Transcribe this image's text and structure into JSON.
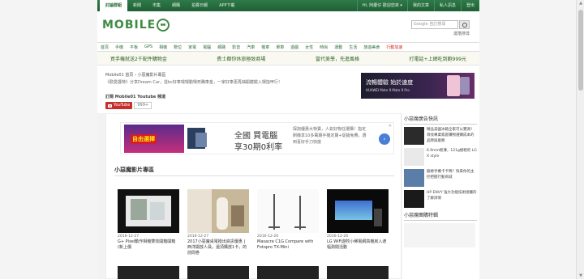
{
  "topbar": {
    "tabs": [
      "討論群組",
      "新聞",
      "市集",
      "網購",
      "拍賣日報",
      "APP下載"
    ],
    "user_links": [
      "Hi, 阿慶仔 歡迎您來 ▾",
      "我的文章",
      "私人訊息",
      "登出"
    ]
  },
  "header": {
    "brand": "MOBILE",
    "search_placeholder": "Google 自訂搜尋",
    "advanced_search": "進階搜尋"
  },
  "nav": {
    "items": [
      "首頁",
      "手機",
      "平板",
      "GPS",
      "相機",
      "數位",
      "家電",
      "電腦",
      "網路",
      "影音",
      "汽車",
      "機車",
      "單車",
      "遊戲",
      "女性",
      "時尚",
      "運動",
      "生活",
      "旅遊美食",
      "行動加速"
    ],
    "highlight_color": "#d12b2b"
  },
  "promo": [
    "買手機就送2千配件購物金",
    "賓士都你休旅極致商場",
    "當代美學，先進風格",
    "打電話+上網吃到飽999元"
  ],
  "breadcrumbs": "Mobile01 首頁 › 小惡魔影片專區",
  "intro": "《歡愛護特》分享Dream Car，從bc好車嘿嘿動場死職車金，一家好車更再抽開體驗入場指甲行！",
  "subscribe_label": "訂閱 Mobile01 Youtube 頻道",
  "youtube": {
    "button": "YouTube",
    "count": "999+"
  },
  "banner": {
    "headline": "流暢體驗 始於速度",
    "sub": "HUAWEI Mate 9 Mate 9 Pro"
  },
  "ad": {
    "thumb_label": "自由選擇",
    "line1": "全國 買電腦",
    "line2": "享30期0利率",
    "small": "探詢優惠大特賣，人氣好物任選購！指定刷機享10多萬期手機定期+促銷免費，選到喜好手刀快搶",
    "close": "✕"
  },
  "section": {
    "title": "小惡魔影片專區"
  },
  "videos": [
    {
      "date": "2016-12-27",
      "title": "G+ Pixel動作相機雙效開箱開箱(新上價"
    },
    {
      "date": "2016-12-27",
      "title": "2017小惡魔桌電撥出資訊優惠 | 西洋開放人員，還須購放1卡，的前問卷"
    },
    {
      "date": "2016-12-26",
      "title": "Masacre C1G Compare with Fotopro TX-Mini"
    },
    {
      "date": "2016-12-26",
      "title": "LG WiFi遊牧小稀電網高機房入遮幅測閱活動"
    }
  ],
  "sidebar": {
    "ads_title": "小惡魔廣告快訊",
    "ads": [
      "精品美國冰箱全家可以實測！尋找專業家庭購物選購成本的品牌與服務",
      "6.9mm輕薄，121g極輕的 LG X style",
      "龍捲手機卡卡嗎？快來你的主控把握行動商城",
      "HP ENVY 強大功能技術接觸的了解詳情"
    ],
    "buy_title": "小惡魔團購特輯"
  }
}
